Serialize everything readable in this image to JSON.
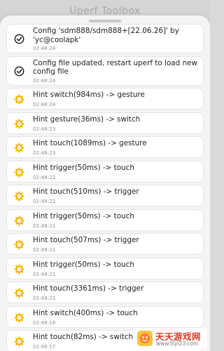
{
  "backdrop": {
    "title": "Uperf Toolbox"
  },
  "log_entries": [
    {
      "kind": "check",
      "icon": "check-circle-icon",
      "text": "Config 'sdm888/sdm888+[22.06.26]' by 'yc@coolapk'",
      "time": "02:48:24"
    },
    {
      "kind": "check",
      "icon": "check-circle-icon",
      "text": "Config file updated, restart uperf to load new config file",
      "time": "02:48:24"
    },
    {
      "kind": "hint",
      "icon": "hint-gear-icon",
      "text": "Hint switch(984ms) -> gesture",
      "time": "02:48:24"
    },
    {
      "kind": "hint",
      "icon": "hint-gear-icon",
      "text": "Hint gesture(36ms) -> switch",
      "time": "02:48:23"
    },
    {
      "kind": "hint",
      "icon": "hint-gear-icon",
      "text": "Hint touch(1089ms) -> gesture",
      "time": "02:48:23"
    },
    {
      "kind": "hint",
      "icon": "hint-gear-icon",
      "text": "Hint trigger(50ms) -> touch",
      "time": "02:48:22"
    },
    {
      "kind": "hint",
      "icon": "hint-gear-icon",
      "text": "Hint touch(510ms) -> trigger",
      "time": "02:48:22"
    },
    {
      "kind": "hint",
      "icon": "hint-gear-icon",
      "text": "Hint trigger(50ms) -> touch",
      "time": "02:48:21"
    },
    {
      "kind": "hint",
      "icon": "hint-gear-icon",
      "text": "Hint touch(507ms) -> trigger",
      "time": "02:48:21"
    },
    {
      "kind": "hint",
      "icon": "hint-gear-icon",
      "text": "Hint trigger(50ms) -> touch",
      "time": "02:48:21"
    },
    {
      "kind": "hint",
      "icon": "hint-gear-icon",
      "text": "Hint touch(3361ms) -> trigger",
      "time": "02:48:21"
    },
    {
      "kind": "hint",
      "icon": "hint-gear-icon",
      "text": "Hint switch(400ms) -> touch",
      "time": "02:48:18"
    },
    {
      "kind": "hint",
      "icon": "hint-gear-icon",
      "text": "Hint touch(82ms) -> switch",
      "time": "02:48:17"
    }
  ],
  "watermark": {
    "title": "天天游戏网",
    "url": "www.ttyl23.com"
  },
  "colors": {
    "check_icon": "#222222",
    "hint_icon": "#f2b705",
    "watermark_brand": "#d93a22"
  }
}
